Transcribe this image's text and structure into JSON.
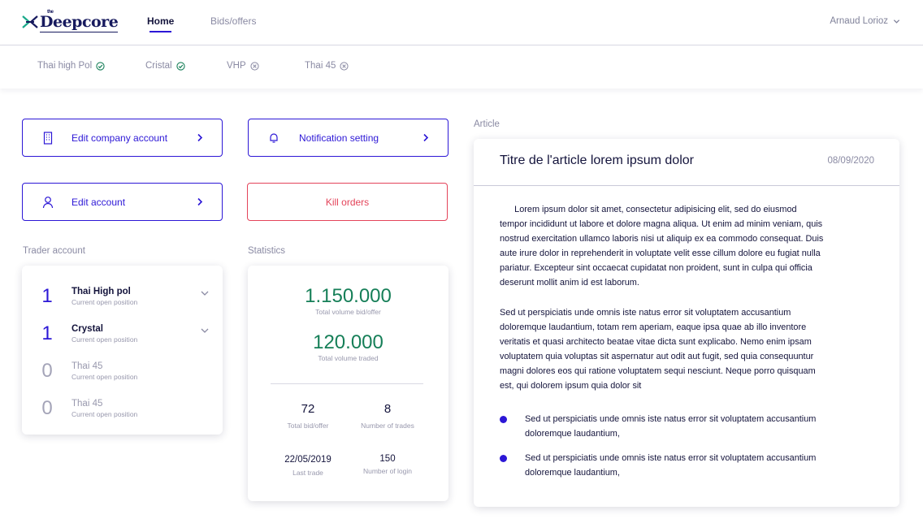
{
  "app": {
    "logo_text": "Deepcore",
    "logo_sup": "the"
  },
  "nav": {
    "home": "Home",
    "bids": "Bids/offers"
  },
  "user": {
    "name": "Arnaud Lorioz"
  },
  "products": [
    {
      "label": "Thai high Pol",
      "status": "check"
    },
    {
      "label": "Cristal",
      "status": "check"
    },
    {
      "label": "VHP",
      "status": "cross"
    },
    {
      "label": "Thai 45",
      "status": "cross"
    }
  ],
  "actions": {
    "edit_company": "Edit company account",
    "notification": "Notification setting",
    "edit_account": "Edit account",
    "kill_orders": "Kill orders"
  },
  "sections": {
    "trader": "Trader account",
    "statistics": "Statistics",
    "article": "Article"
  },
  "trader_rows": [
    {
      "count": "1",
      "name": "Thai High pol",
      "sub": "Current open position"
    },
    {
      "count": "1",
      "name": "Crystal",
      "sub": "Current open position"
    },
    {
      "count": "0",
      "name": "Thai 45",
      "sub": "Current open position"
    },
    {
      "count": "0",
      "name": "Thai 45",
      "sub": "Current open position"
    }
  ],
  "statistics": {
    "volume_bid_offer": "1.150.000",
    "volume_bid_offer_label": "Total volume bid/offer",
    "volume_traded": "120.000",
    "volume_traded_label": "Total volume traded",
    "total_bid_offer": "72",
    "total_bid_offer_label": "Total bid/offer",
    "number_trades": "8",
    "number_trades_label": "Number of trades",
    "last_trade": "22/05/2019",
    "last_trade_label": "Last trade",
    "number_login": "150",
    "number_login_label": "Number of login"
  },
  "article": {
    "title": "Titre de l'article lorem ipsum dolor",
    "date": "08/09/2020",
    "p1_lines": [
      "      Lorem ipsum dolor sit amet, consectetur adipisicing elit, sed do eiusmod",
      "tempor incididunt ut labore et dolore magna aliqua. Ut enim ad minim veniam, quis",
      "nostrud exercitation ullamco laboris nisi ut aliquip ex ea commodo consequat. Duis",
      "aute irure dolor in reprehenderit in voluptate velit esse cillum dolore eu fugiat nulla",
      "pariatur. Excepteur sint occaecat cupidatat non proident, sunt in culpa qui officia",
      "deserunt mollit anim id est laborum."
    ],
    "p2_lines": [
      "Sed ut perspiciatis unde omnis iste natus error sit voluptatem accusantium",
      "doloremque laudantium, totam rem aperiam, eaque ipsa quae ab illo inventore",
      "veritatis et quasi architecto beatae vitae dicta sunt explicabo. Nemo enim ipsam",
      "voluptatem quia voluptas sit aspernatur aut odit aut fugit, sed quia consequuntur",
      "magni dolores eos qui ratione voluptatem sequi nesciunt. Neque porro quisquam",
      "est, qui dolorem ipsum quia dolor sit"
    ],
    "bullets": [
      [
        "Sed ut perspiciatis unde omnis iste natus error sit voluptatem accusantium",
        "doloremque laudantium,"
      ],
      [
        "Sed ut perspiciatis unde omnis iste natus error sit voluptatem accusantium",
        "doloremque laudantium,"
      ]
    ]
  },
  "colors": {
    "primary": "#2c17d6",
    "navy": "#171a5e",
    "success": "#167f58",
    "danger": "#e4445a",
    "muted": "#8a8aa3"
  },
  "icons": {
    "logo": "deepcore-logo-icon",
    "user_dropdown": "chevron-down-icon",
    "product_active": "check-circle-icon",
    "product_inactive": "x-circle-icon",
    "company": "building-icon",
    "notification": "bell-icon",
    "account": "user-icon",
    "action_arrow": "chevron-right-icon",
    "expand": "chevron-down-icon",
    "bullet": "bullet-dot-icon"
  }
}
